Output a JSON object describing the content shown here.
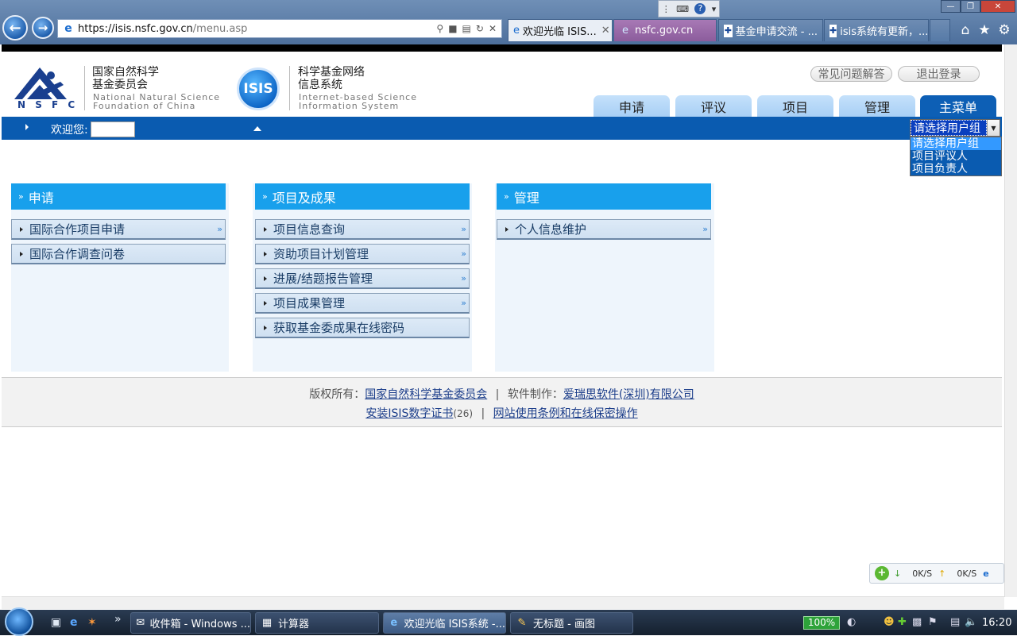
{
  "browser": {
    "url_main": "https://isis.nsfc.gov.cn",
    "url_path": "/menu.asp",
    "tabs": [
      {
        "label": "欢迎光临 ISIS...",
        "active": true
      },
      {
        "label": "nsfc.gov.cn",
        "active": false
      },
      {
        "label": "基金申请交流 - ...",
        "active": false
      },
      {
        "label": "isis系统有更新，...",
        "active": false
      }
    ]
  },
  "header": {
    "nsfc_cn_line1": "国家自然科学",
    "nsfc_cn_line2": "基金委员会",
    "nsfc_en_line1": "National Natural Science",
    "nsfc_en_line2": "Foundation of China",
    "nsfc_logo_letters": "N S F C",
    "isis_logo": "ISIS",
    "isis_cn_line1": "科学基金网络",
    "isis_cn_line2": "信息系统",
    "isis_en_line1": "Internet-based Science",
    "isis_en_line2": "Information System",
    "faq_label": "常见问题解答",
    "logout_label": "退出登录",
    "nav_tabs": [
      "申请",
      "评议",
      "项目",
      "管理",
      "主菜单"
    ]
  },
  "bluebar": {
    "welcome": "欢迎您:"
  },
  "usergroup_select": {
    "selected": "请选择用户组",
    "options": [
      "请选择用户组",
      "项目评议人",
      "项目负责人"
    ]
  },
  "columns": [
    {
      "title": "申请",
      "items": [
        {
          "label": "国际合作项目申请",
          "has_arrow": true
        },
        {
          "label": "国际合作调查问卷",
          "has_arrow": false
        }
      ]
    },
    {
      "title": "项目及成果",
      "items": [
        {
          "label": "项目信息查询",
          "has_arrow": true
        },
        {
          "label": "资助项目计划管理",
          "has_arrow": true
        },
        {
          "label": "进展/结题报告管理",
          "has_arrow": true
        },
        {
          "label": "项目成果管理",
          "has_arrow": true
        },
        {
          "label": "获取基金委成果在线密码",
          "has_arrow": false
        }
      ]
    },
    {
      "title": "管理",
      "items": [
        {
          "label": "个人信息维护",
          "has_arrow": true
        }
      ]
    }
  ],
  "footer": {
    "copyright_prefix": "版权所有：",
    "copyright_link": "国家自然科学基金委员会",
    "sep": "|",
    "software_prefix": "软件制作：",
    "software_link": "爱瑞思软件(深圳)有限公司",
    "install_cert_link": "安装ISIS数字证书",
    "install_cert_count": "(26)",
    "terms_link": "网站使用条例和在线保密操作"
  },
  "net_widget": {
    "down": "0K/S",
    "up": "0K/S"
  },
  "taskbar": {
    "buttons": [
      {
        "label": "收件箱 - Windows ...",
        "icon": "mail-icon"
      },
      {
        "label": "计算器",
        "icon": "calculator-icon"
      },
      {
        "label": "欢迎光临 ISIS系统 -...",
        "icon": "ie-icon"
      },
      {
        "label": "无标题 - 画图",
        "icon": "paint-icon"
      }
    ],
    "battery": "100%",
    "clock": "16:20"
  }
}
